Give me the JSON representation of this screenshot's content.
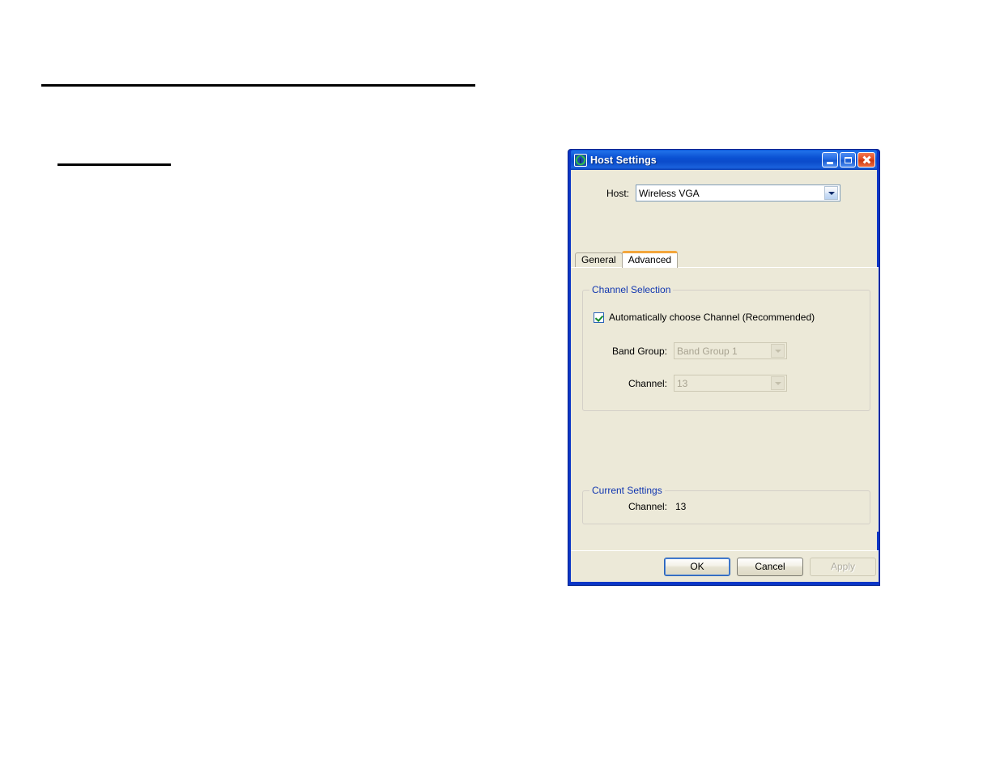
{
  "document": {
    "rules": [
      {
        "name": "top-rule"
      },
      {
        "name": "section-rule"
      }
    ]
  },
  "dialog": {
    "titlebar": {
      "icon": "host-settings-icon",
      "title": "Host Settings",
      "buttons": {
        "minimize": "minimize-icon",
        "maximize": "maximize-icon",
        "close": "close-icon"
      }
    },
    "host": {
      "label": "Host:",
      "value": "Wireless VGA",
      "dropdown_icon": "chevron-down-icon"
    },
    "tabs": [
      {
        "label": "General",
        "active": false
      },
      {
        "label": "Advanced",
        "active": true
      }
    ],
    "channel_selection": {
      "title": "Channel Selection",
      "auto_checkbox": {
        "label": "Automatically choose Channel (Recommended)",
        "checked": true
      },
      "band_group": {
        "label": "Band Group:",
        "value": "Band Group 1",
        "enabled": false
      },
      "channel": {
        "label": "Channel:",
        "value": "13",
        "enabled": false
      }
    },
    "current_settings": {
      "title": "Current Settings",
      "channel_label": "Channel:",
      "channel_value": "13"
    },
    "buttons": {
      "ok": "OK",
      "cancel": "Cancel",
      "apply": "Apply"
    }
  },
  "colors": {
    "titlebar_blue": "#0a51d2",
    "frame_blue": "#0A36C6",
    "dialog_face": "#ece9d8",
    "group_title_blue": "#1136b0",
    "active_tab_accent": "#f3a63b",
    "close_red": "#e24a21",
    "check_green": "#128a2a"
  }
}
